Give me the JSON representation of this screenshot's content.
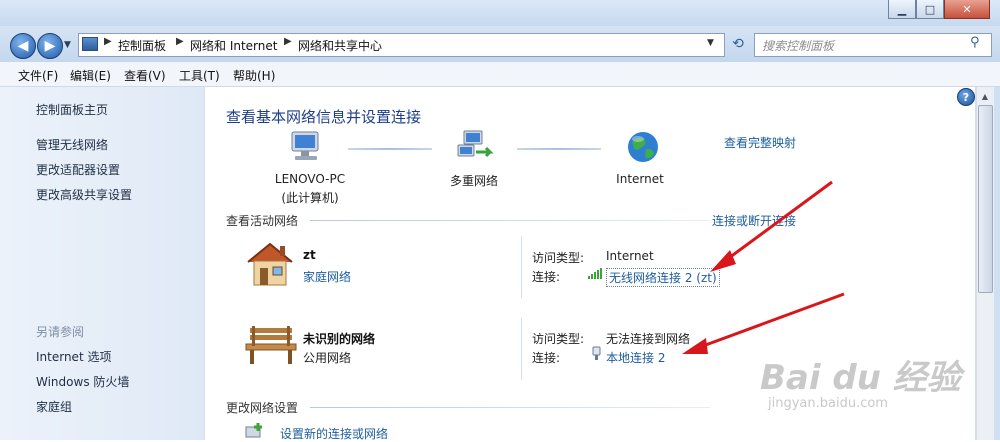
{
  "window": {
    "controls": {
      "minimize": "▁",
      "maximize": "□",
      "close": "✕"
    }
  },
  "address": {
    "crumbs": [
      "控制面板",
      "网络和 Internet",
      "网络和共享中心"
    ],
    "search_placeholder": "搜索控制面板"
  },
  "menu": {
    "items": [
      "文件(F)",
      "编辑(E)",
      "查看(V)",
      "工具(T)",
      "帮助(H)"
    ]
  },
  "sidebar": {
    "home": "控制面板主页",
    "links": [
      "管理无线网络",
      "更改适配器设置",
      "更改高级共享设置"
    ],
    "see_also_title": "另请参阅",
    "see_also": [
      "Internet 选项",
      "Windows 防火墙",
      "家庭组"
    ]
  },
  "main": {
    "title": "查看基本网络信息并设置连接",
    "full_map": "查看完整映射",
    "map_nodes": {
      "pc_name": "LENOVO-PC",
      "pc_sub": "(此计算机)",
      "middle": "多重网络",
      "internet": "Internet"
    },
    "active_title": "查看活动网络",
    "connect_link": "连接或断开连接",
    "networks": [
      {
        "name": "zt",
        "type": "家庭网络",
        "access_label": "访问类型:",
        "access_value": "Internet",
        "conn_label": "连接:",
        "conn_value": "无线网络连接 2 (zt)"
      },
      {
        "name": "未识别的网络",
        "type": "公用网络",
        "access_label": "访问类型:",
        "access_value": "无法连接到网络",
        "conn_label": "连接:",
        "conn_value": "本地连接 2"
      }
    ],
    "change_title": "更改网络设置",
    "setup_link": "设置新的连接或网络"
  },
  "watermark": {
    "brand": "Bai du 经验",
    "url": "jingyan.baidu.com"
  },
  "colors": {
    "link": "#1c5d9f",
    "heading": "#1e3f87",
    "annotation_arrow": "#d9161b"
  }
}
